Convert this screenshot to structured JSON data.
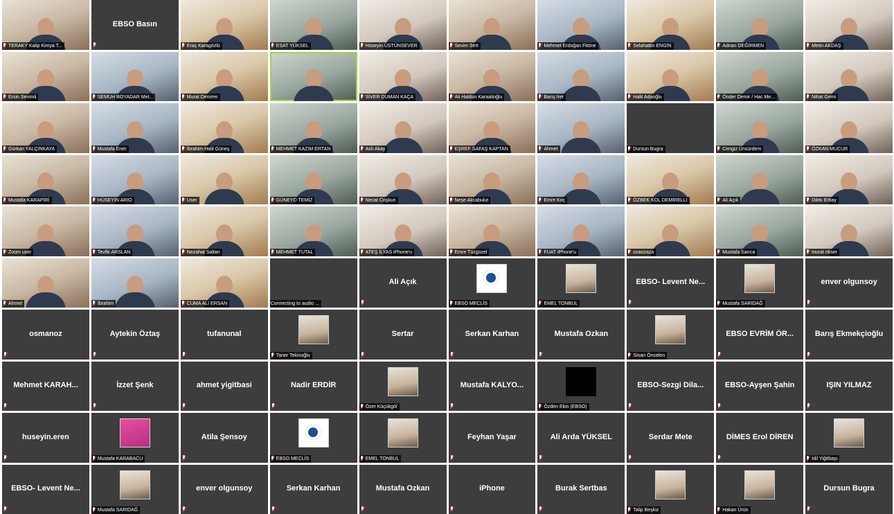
{
  "app": {
    "view": "gallery",
    "colors": {
      "tile_background": "#3d3d3d",
      "tile_text": "#ffffff",
      "muted_mic": "#ff2e2e",
      "active_speaker_border": "#9ad74a"
    }
  },
  "participants": [
    {
      "name": "TERAKY Kalip Kimya T...",
      "mode": "video",
      "muted": true
    },
    {
      "name": "EBSO Basın",
      "mode": "name",
      "muted": true
    },
    {
      "name": "Eraç Karagözlü",
      "mode": "video",
      "muted": true
    },
    {
      "name": "ESAT YÜKSEL",
      "mode": "video",
      "muted": true
    },
    {
      "name": "Hüseyin ÜSTÜNSEVER",
      "mode": "video",
      "muted": true
    },
    {
      "name": "Sevim Sert",
      "mode": "video",
      "muted": true
    },
    {
      "name": "Mehmet Erdoğan Fitöne",
      "mode": "video",
      "muted": true
    },
    {
      "name": "Selahattin ENGİN",
      "mode": "video",
      "muted": true
    },
    {
      "name": "Adnan DEĞİRMEN",
      "mode": "video",
      "muted": true
    },
    {
      "name": "Metin AKDAŞ",
      "mode": "video",
      "muted": true
    },
    {
      "name": "Ersin Sevimli",
      "mode": "video",
      "muted": true
    },
    {
      "name": "SEMUH BOYADAR Met...",
      "mode": "video",
      "muted": true
    },
    {
      "name": "Murat Demirer",
      "mode": "video",
      "muted": true
    },
    {
      "name": "",
      "mode": "video",
      "muted": false,
      "speaker": true
    },
    {
      "name": "SİVER DUMAN KAÇA",
      "mode": "video",
      "muted": true
    },
    {
      "name": "Ali Haldun Karaalioğlu",
      "mode": "video",
      "muted": true
    },
    {
      "name": "Barış Irer",
      "mode": "video",
      "muted": true
    },
    {
      "name": "Halit Adaoğlu",
      "mode": "video",
      "muted": true
    },
    {
      "name": "Önder Demir / Hac Me...",
      "mode": "video",
      "muted": true
    },
    {
      "name": "Nihat Gemi",
      "mode": "video",
      "muted": true
    },
    {
      "name": "Gürkan YALÇINKAYA",
      "mode": "video",
      "muted": true
    },
    {
      "name": "Mustafa Ener",
      "mode": "video",
      "muted": true
    },
    {
      "name": "İbrahim Halil Güneş",
      "mode": "video",
      "muted": true
    },
    {
      "name": "MEHMET KAZIM ERTAN",
      "mode": "video",
      "muted": true
    },
    {
      "name": "Aslı Akay",
      "mode": "video",
      "muted": true
    },
    {
      "name": "EŞREF SAFAŞ KAPTAN",
      "mode": "video",
      "muted": true
    },
    {
      "name": "Ahmet",
      "mode": "video",
      "muted": true
    },
    {
      "name": "Dursun Bugra",
      "mode": "name-video",
      "muted": true
    },
    {
      "name": "Cengiz Ünsürdem",
      "mode": "video",
      "muted": true
    },
    {
      "name": "ÖZKAN MUCUR",
      "mode": "video",
      "muted": true
    },
    {
      "name": "Mustafa KARAPİRİ",
      "mode": "video",
      "muted": true
    },
    {
      "name": "HÜSEYİN ARIO",
      "mode": "video",
      "muted": true
    },
    {
      "name": "User",
      "mode": "video",
      "muted": true
    },
    {
      "name": "GÜNEYD TEMİZ",
      "mode": "video",
      "muted": true
    },
    {
      "name": "Necat Coşkun",
      "mode": "video",
      "muted": true
    },
    {
      "name": "Neşe Akcabulut",
      "mode": "video",
      "muted": true
    },
    {
      "name": "Emre Koç",
      "mode": "video",
      "muted": true
    },
    {
      "name": "ÖZBEK KOL DEMİRELLİ",
      "mode": "video",
      "muted": true
    },
    {
      "name": "Ali Açık",
      "mode": "video",
      "muted": true
    },
    {
      "name": "Dilek Erbay",
      "mode": "video",
      "muted": true
    },
    {
      "name": "Zoom user",
      "mode": "video",
      "muted": true
    },
    {
      "name": "Tevfik ARSLAN",
      "mode": "video",
      "muted": true
    },
    {
      "name": "Nezahat Saltan",
      "mode": "video",
      "muted": true
    },
    {
      "name": "MEHMET TUTAL",
      "mode": "video",
      "muted": true
    },
    {
      "name": "ATEŞ İLYAS iPhone'u",
      "mode": "video",
      "muted": true
    },
    {
      "name": "Emre Tüzgüzel",
      "mode": "video",
      "muted": true
    },
    {
      "name": "FUAT iPhone'u",
      "mode": "video",
      "muted": true
    },
    {
      "name": "ozaozaza",
      "mode": "video",
      "muted": true
    },
    {
      "name": "Mustafa Sarıca",
      "mode": "video",
      "muted": true
    },
    {
      "name": "murat nkser",
      "mode": "video",
      "muted": true
    },
    {
      "name": "Ahmet",
      "mode": "video",
      "muted": true
    },
    {
      "name": "İbrahim",
      "mode": "video",
      "muted": true
    },
    {
      "name": "CUMA ALİ ERSAN",
      "mode": "video",
      "muted": true
    },
    {
      "name": "Connecting to audio ...",
      "mode": "name-blank",
      "muted": false
    },
    {
      "name": "Ali Açık",
      "mode": "name",
      "muted": true
    },
    {
      "name": "EBSO MECLİS",
      "mode": "logo",
      "muted": true
    },
    {
      "name": "EMEL TONBUL",
      "mode": "photo",
      "muted": true
    },
    {
      "name": "EBSO- Levent Ne...",
      "mode": "name",
      "muted": true
    },
    {
      "name": "Mustafa SARIDAĞ",
      "mode": "photo",
      "muted": true
    },
    {
      "name": "enver olgunsoy",
      "mode": "name",
      "muted": true
    },
    {
      "name": "osmanoz",
      "mode": "name",
      "muted": true
    },
    {
      "name": "Aytekin Öztaş",
      "mode": "name",
      "muted": true
    },
    {
      "name": "tufanunal",
      "mode": "name",
      "muted": true
    },
    {
      "name": "Taner Tekinoğlu",
      "mode": "photo",
      "muted": true
    },
    {
      "name": "Sertar",
      "mode": "name",
      "muted": true
    },
    {
      "name": "Serkan Karhan",
      "mode": "name",
      "muted": true
    },
    {
      "name": "Mustafa Ozkan",
      "mode": "name",
      "muted": true
    },
    {
      "name": "Sinan Öncelen",
      "mode": "photo",
      "muted": true
    },
    {
      "name": "EBSO EVRİM ÖR...",
      "mode": "name",
      "muted": true
    },
    {
      "name": "Barış Ekmekçioğlu",
      "mode": "name",
      "muted": true
    },
    {
      "name": "Mehmet KARAH...",
      "mode": "name",
      "muted": true
    },
    {
      "name": "İzzet Şenk",
      "mode": "name",
      "muted": true
    },
    {
      "name": "ahmet yigitbasi",
      "mode": "name",
      "muted": true
    },
    {
      "name": "Nadir ERDİR",
      "mode": "name",
      "muted": true
    },
    {
      "name": "Özer Küçükgöl",
      "mode": "photo",
      "muted": true
    },
    {
      "name": "Mustafa KALYO...",
      "mode": "name",
      "muted": true
    },
    {
      "name": "Özden Ekin (EBSO)",
      "mode": "black",
      "muted": true
    },
    {
      "name": "EBSO-Sezgi Dila...",
      "mode": "name",
      "muted": true
    },
    {
      "name": "EBSO-Ayşen Şahin",
      "mode": "name",
      "muted": true
    },
    {
      "name": "IŞIN YILMAZ",
      "mode": "name",
      "muted": true
    },
    {
      "name": "huseyin.eren",
      "mode": "name",
      "muted": true
    },
    {
      "name": "Mustafa KARABACU",
      "mode": "pink",
      "muted": true
    },
    {
      "name": "Atila Şensoy",
      "mode": "name",
      "muted": true
    },
    {
      "name": "EBSO MECLİS",
      "mode": "logo",
      "muted": true
    },
    {
      "name": "EMEL TONBUL",
      "mode": "photo",
      "muted": true
    },
    {
      "name": "Feyhan Yaşar",
      "mode": "name",
      "muted": true
    },
    {
      "name": "Ali Arda YÜKSEL",
      "mode": "name",
      "muted": true
    },
    {
      "name": "Serdar Mete",
      "mode": "name",
      "muted": true
    },
    {
      "name": "DİMES Erol DİREN",
      "mode": "name",
      "muted": true
    },
    {
      "name": "İdil Yiğitbaşı",
      "mode": "photo",
      "muted": true
    },
    {
      "name": "EBSO- Levent Ne...",
      "mode": "name",
      "muted": true
    },
    {
      "name": "Mustafa SARIDAĞ",
      "mode": "photo",
      "muted": true
    },
    {
      "name": "enver olgunsoy",
      "mode": "name",
      "muted": true
    },
    {
      "name": "Serkan Karhan",
      "mode": "name",
      "muted": true
    },
    {
      "name": "Mustafa Ozkan",
      "mode": "name",
      "muted": true
    },
    {
      "name": "iPhone",
      "mode": "name",
      "muted": true
    },
    {
      "name": "Burak Sertbas",
      "mode": "name",
      "muted": true
    },
    {
      "name": "Talip Beşkiz",
      "mode": "photo",
      "muted": true
    },
    {
      "name": "Hakan Ürün",
      "mode": "photo",
      "muted": true
    },
    {
      "name": "Dursun Bugra",
      "mode": "name",
      "muted": true
    }
  ]
}
